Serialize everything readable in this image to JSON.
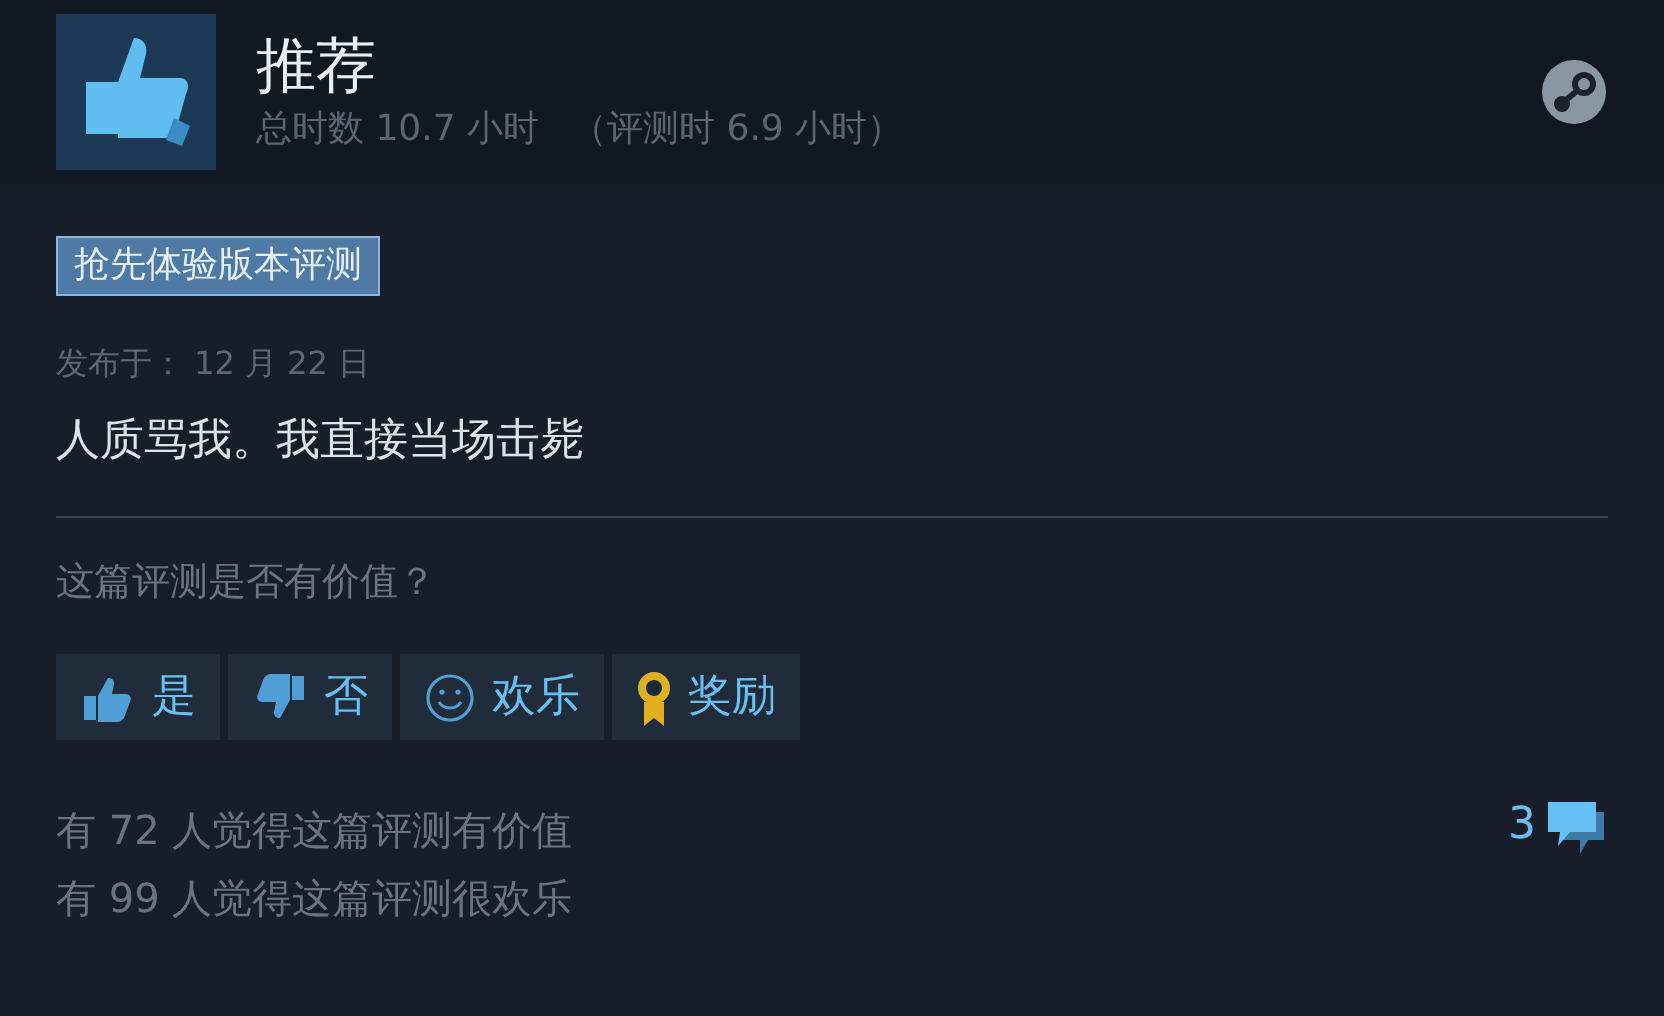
{
  "header": {
    "verdict": "推荐",
    "playtime": "总时数 10.7 小时",
    "playtime_at_review": "（评测时 6.9 小时）"
  },
  "badge": "抢先体验版本评测",
  "posted": "发布于： 12 月 22 日",
  "review_text": "人质骂我。我直接当场击毙",
  "question": "这篇评测是否有价值？",
  "buttons": [
    {
      "kind": "yes",
      "label": "是"
    },
    {
      "kind": "no",
      "label": "否"
    },
    {
      "kind": "funny",
      "label": "欢乐"
    },
    {
      "kind": "award",
      "label": "奖励"
    }
  ],
  "stats": [
    "有 72 人觉得这篇评测有价值",
    "有 99 人觉得这篇评测很欢乐"
  ],
  "comment_count": "3"
}
